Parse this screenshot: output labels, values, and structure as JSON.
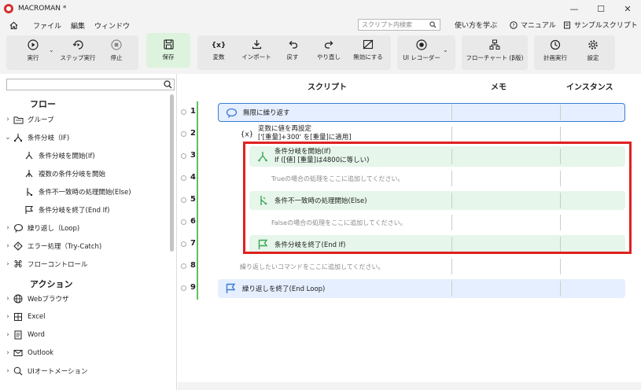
{
  "window": {
    "title": "MACROMAN *",
    "minimize": "—",
    "maximize": "☐",
    "close": "✕"
  },
  "menu": {
    "items": [
      "ファイル",
      "編集",
      "ウィンドウ"
    ],
    "search_placeholder": "スクリプト内検索",
    "learn": "使い方を学ぶ",
    "manual": "マニュアル",
    "samples": "サンプルスクリプト"
  },
  "toolbar": {
    "run": "実行",
    "step": "ステップ実行",
    "stop": "停止",
    "save": "保存",
    "variable": "変数",
    "import": "インポート",
    "undo": "戻す",
    "redo": "やり直し",
    "disable": "無効にする",
    "ui_recorder": "UI レコーダー",
    "flowchart": "フローチャート (β版)",
    "schedule": "計画実行",
    "settings": "設定"
  },
  "sidebar": {
    "flow_header": "フロー",
    "action_header": "アクション",
    "flow_items": [
      "グループ",
      "条件分岐（IF)",
      "条件分岐を開始(If)",
      "複数の条件分岐を開始",
      "条件不一致時の処理開始(Else)",
      "条件分岐を終了(End If)",
      "繰り返し（Loop)",
      "エラー処理（Try-Catch)",
      "フローコントロール"
    ],
    "action_items": [
      "Webブラウザ",
      "Excel",
      "Word",
      "Outlook",
      "UIオートメーション"
    ]
  },
  "script": {
    "headers": {
      "script": "スクリプト",
      "memo": "メモ",
      "instance": "インスタンス"
    },
    "line_numbers": [
      "1",
      "2",
      "3",
      "4",
      "5",
      "6",
      "7",
      "8",
      "9"
    ],
    "row1": "無限に繰り返す",
    "row2_title": "変数に値を再設定",
    "row2_detail": "['[重量]+300' を[重量]に適用]",
    "row3_title": "条件分岐を開始(If)",
    "row3_detail": "If ([値] [重量]は4800に等しい)",
    "row4": "Trueの場合の処理をここに追加してください。",
    "row5": "条件不一致時の処理開始(Else)",
    "row6": "Falseの場合の処理をここに追加してください。",
    "row7": "条件分岐を終了(End If)",
    "row8": "繰り返したいコマンドをここに追加してください。",
    "row9": "繰り返しを終了(End Loop)"
  },
  "colors": {
    "highlight_frame": "#e02020",
    "if_block": "#e6f6ea",
    "loop_block": "#e6efff",
    "loop_border": "#3a7bd5"
  }
}
